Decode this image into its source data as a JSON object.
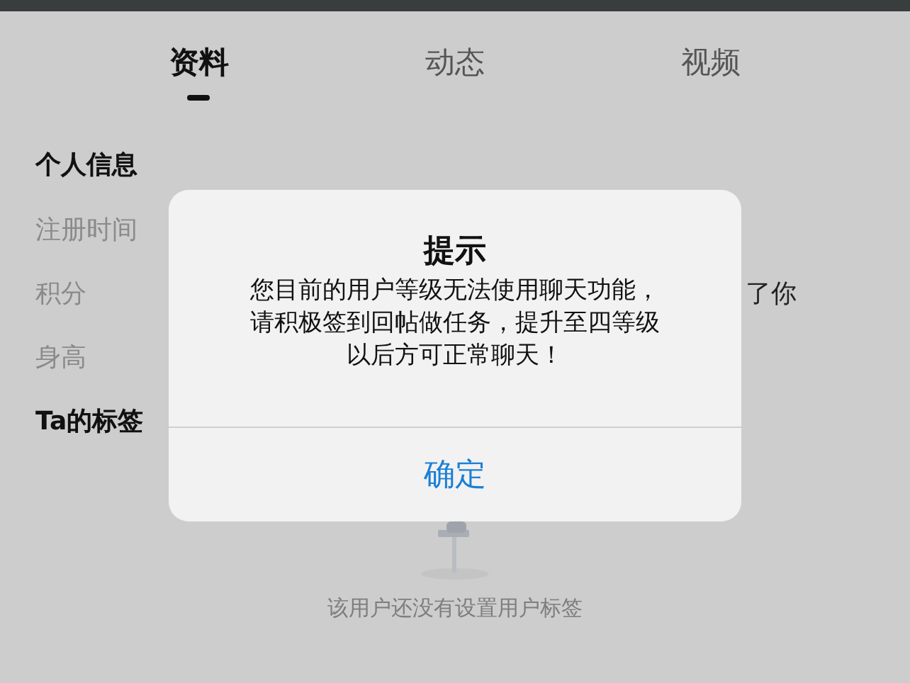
{
  "tabs": [
    {
      "label": "资料",
      "selected": true
    },
    {
      "label": "动态",
      "selected": false
    },
    {
      "label": "视频",
      "selected": false
    }
  ],
  "profile": {
    "title": "个人信息",
    "rows": [
      {
        "label": "注册时间"
      },
      {
        "label": "积分",
        "value": "了你"
      },
      {
        "label": "身高"
      }
    ]
  },
  "tags": {
    "title": "Ta的标签",
    "empty_text": "该用户还没有设置用户标签"
  },
  "dialog": {
    "title": "提示",
    "message_lines": [
      "您目前的用户等级无法使用聊天功能，",
      "请积极签到回帖做任务，提升至四等级",
      "以后方可正常聊天！"
    ],
    "button": "确定"
  }
}
